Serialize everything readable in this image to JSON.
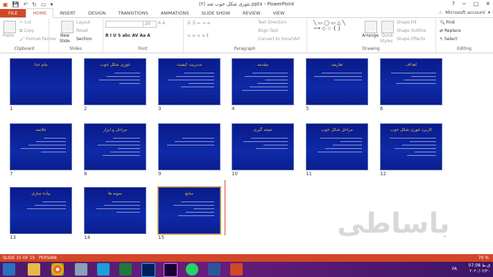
{
  "window": {
    "title": "(۲) تئوری شکل خوب شد.pptx - PowerPoint",
    "help": "?",
    "minimize": "−",
    "restore": "□",
    "close": "✕"
  },
  "tabs": [
    {
      "label": "FILE"
    },
    {
      "label": "HOME"
    },
    {
      "label": "INSERT"
    },
    {
      "label": "DESIGN"
    },
    {
      "label": "TRANSITIONS"
    },
    {
      "label": "ANIMATIONS"
    },
    {
      "label": "SLIDE SHOW"
    },
    {
      "label": "REVIEW"
    },
    {
      "label": "VIEW"
    }
  ],
  "account": {
    "label": "Microsoft account"
  },
  "ribbon": {
    "clipboard": {
      "label": "Clipboard",
      "paste": "Paste",
      "cut": "Cut",
      "copy": "Copy",
      "format_painter": "Format Painter"
    },
    "slides": {
      "label": "Slides",
      "new_slide": "New",
      "new_slide2": "Slide",
      "layout": "Layout",
      "reset": "Reset",
      "section": "Section"
    },
    "font": {
      "label": "Font",
      "size": "20"
    },
    "paragraph": {
      "label": "Paragraph",
      "text_direction": "Text Direction",
      "align_text": "Align Text",
      "smartart": "Convert to SmartArt"
    },
    "drawing": {
      "label": "Drawing",
      "arrange": "Arrange",
      "quick_styles": "Quick",
      "quick_styles2": "Styles",
      "shape_fill": "Shape Fill",
      "shape_outline": "Shape Outline",
      "shape_effects": "Shape Effects"
    },
    "editing": {
      "label": "Editing",
      "find": "Find",
      "replace": "Replace",
      "select": "Select"
    }
  },
  "slides": [
    {
      "num": "1",
      "title": "بنام خدا"
    },
    {
      "num": "2",
      "title": "تئوری شکل خوب"
    },
    {
      "num": "3",
      "title": "مدیریت کیفیت"
    },
    {
      "num": "4",
      "title": "مقدمه"
    },
    {
      "num": "5",
      "title": "تعاریف"
    },
    {
      "num": "6",
      "title": "اهداف"
    },
    {
      "num": "7",
      "title": "خلاصه"
    },
    {
      "num": "8",
      "title": "مراحل و ابزار"
    },
    {
      "num": "9",
      "title": ""
    },
    {
      "num": "10",
      "title": "نتیجه گیری"
    },
    {
      "num": "11",
      "title": "مراحل شکل خوب"
    },
    {
      "num": "12",
      "title": "کاربرد تئوری شکل خوب"
    },
    {
      "num": "13",
      "title": "پیاده سازی"
    },
    {
      "num": "14",
      "title": "نمونه ها"
    },
    {
      "num": "15",
      "title": "منابع"
    }
  ],
  "watermark": "باساطی",
  "status": {
    "slide": "SLIDE 15 OF 15",
    "language": "PERSIAN",
    "zoom": "70 %"
  },
  "taskbar": {
    "lang": "FA",
    "time": "07:08",
    "date": "۲۰۲۰/۰۲/۲۰",
    "day": "ق.ظ"
  },
  "colors": {
    "accent": "#d24726",
    "slide_bg": "#0e2aa8",
    "slide_title": "#e8c23a"
  }
}
